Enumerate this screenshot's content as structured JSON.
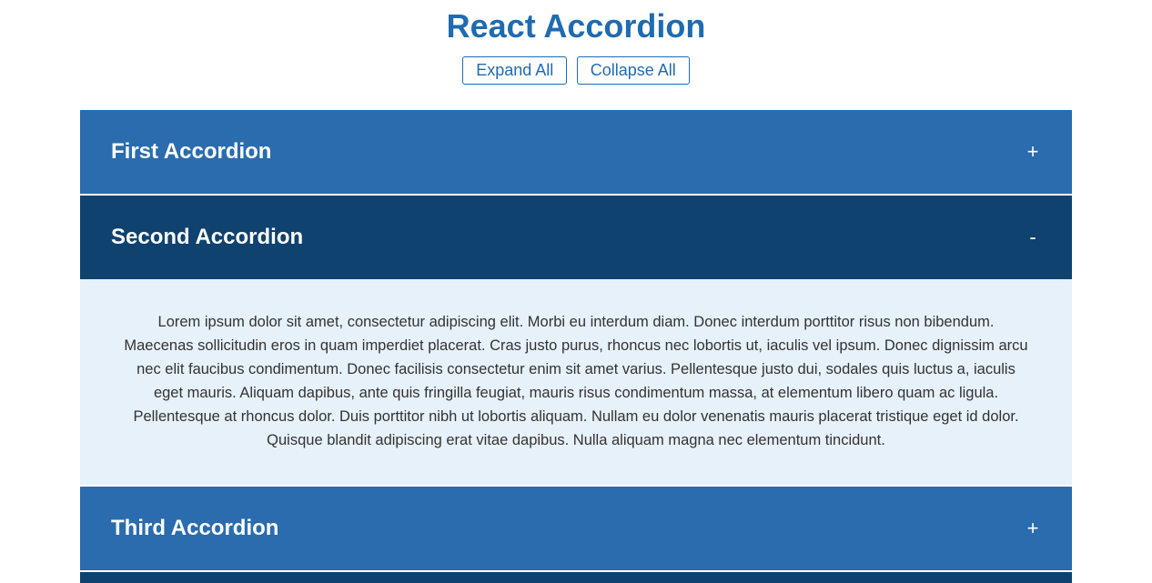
{
  "title": "React Accordion",
  "controls": {
    "expand_label": "Expand All",
    "collapse_label": "Collapse All"
  },
  "accordion": {
    "items": [
      {
        "title": "First Accordion",
        "expanded": false,
        "indicator": "+"
      },
      {
        "title": "Second Accordion",
        "expanded": true,
        "indicator": "-",
        "body": "Lorem ipsum dolor sit amet, consectetur adipiscing elit. Morbi eu interdum diam. Donec interdum porttitor risus non bibendum. Maecenas sollicitudin eros in quam imperdiet placerat. Cras justo purus, rhoncus nec lobortis ut, iaculis vel ipsum. Donec dignissim arcu nec elit faucibus condimentum. Donec facilisis consectetur enim sit amet varius. Pellentesque justo dui, sodales quis luctus a, iaculis eget mauris. Aliquam dapibus, ante quis fringilla feugiat, mauris risus condimentum massa, at elementum libero quam ac ligula. Pellentesque at rhoncus dolor. Duis porttitor nibh ut lobortis aliquam. Nullam eu dolor venenatis mauris placerat tristique eget id dolor. Quisque blandit adipiscing erat vitae dapibus. Nulla aliquam magna nec elementum tincidunt."
      },
      {
        "title": "Third Accordion",
        "expanded": false,
        "indicator": "+"
      }
    ]
  }
}
